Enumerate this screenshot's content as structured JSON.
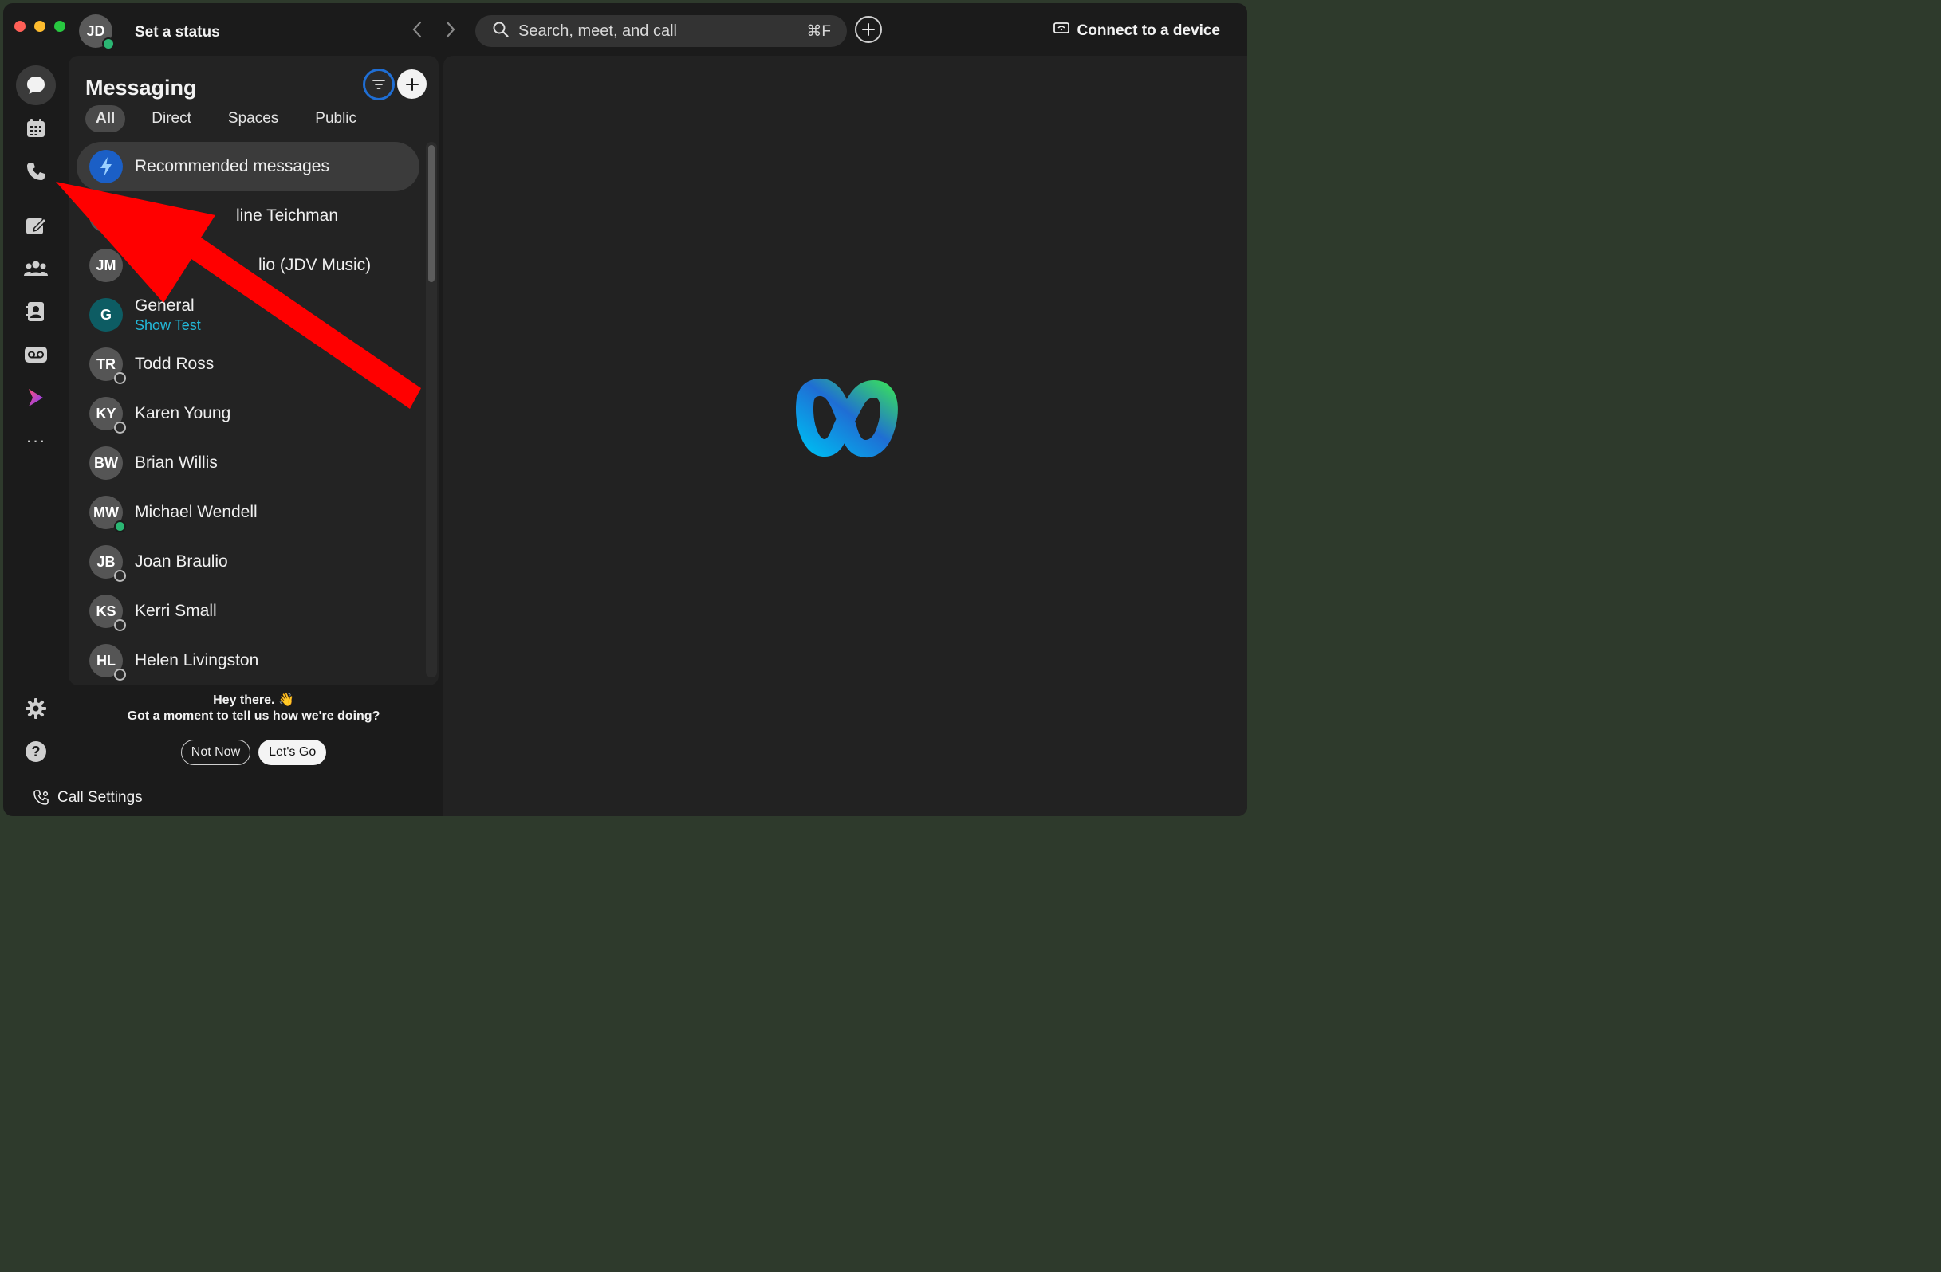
{
  "colors": {
    "accent": "#1f6ed4",
    "presence_green": "#2bb673",
    "link_cyan": "#22b8d8",
    "annotation_red": "#ff0000"
  },
  "header": {
    "user_initials": "JD",
    "status_label": "Set a status",
    "search_placeholder": "Search, meet, and call",
    "search_shortcut": "⌘F",
    "connect_label": "Connect to a device"
  },
  "rail": {
    "icons": [
      "messaging-icon",
      "calendar-icon",
      "calling-icon",
      "whiteboard-icon",
      "teams-icon",
      "contacts-icon",
      "voicemail-icon",
      "vidcast-icon",
      "more-icon"
    ],
    "more_label": "···",
    "bottom_icons": [
      "settings-icon",
      "help-icon"
    ],
    "help_glyph": "?",
    "call_settings_label": "Call Settings"
  },
  "messaging": {
    "title": "Messaging",
    "tabs": [
      "All",
      "Direct",
      "Spaces",
      "Public"
    ],
    "active_tab": "All",
    "conversations": [
      {
        "initials": "",
        "name": "Recommended messages",
        "sub": "",
        "badge": "recommended"
      },
      {
        "initials": "",
        "name": "line Teichman",
        "sub": "",
        "badge": ""
      },
      {
        "initials": "JM",
        "name": "lio (JDV Music)",
        "sub": "",
        "badge": ""
      },
      {
        "initials": "G",
        "name": "General",
        "sub": "Show Test",
        "badge": ""
      },
      {
        "initials": "TR",
        "name": "Todd Ross",
        "sub": "",
        "badge": "clock"
      },
      {
        "initials": "KY",
        "name": "Karen Young",
        "sub": "",
        "badge": "clock"
      },
      {
        "initials": "BW",
        "name": "Brian Willis",
        "sub": "",
        "badge": ""
      },
      {
        "initials": "MW",
        "name": "Michael Wendell",
        "sub": "",
        "badge": "online"
      },
      {
        "initials": "JB",
        "name": "Joan Braulio",
        "sub": "",
        "badge": "clock"
      },
      {
        "initials": "KS",
        "name": "Kerri Small",
        "sub": "",
        "badge": "clock"
      },
      {
        "initials": "HL",
        "name": "Helen Livingston",
        "sub": "",
        "badge": "clock"
      }
    ]
  },
  "survey": {
    "line1": "Hey there. 👋",
    "line2": "Got a moment to tell us how we're doing?",
    "not_now": "Not Now",
    "lets_go": "Let's Go"
  }
}
